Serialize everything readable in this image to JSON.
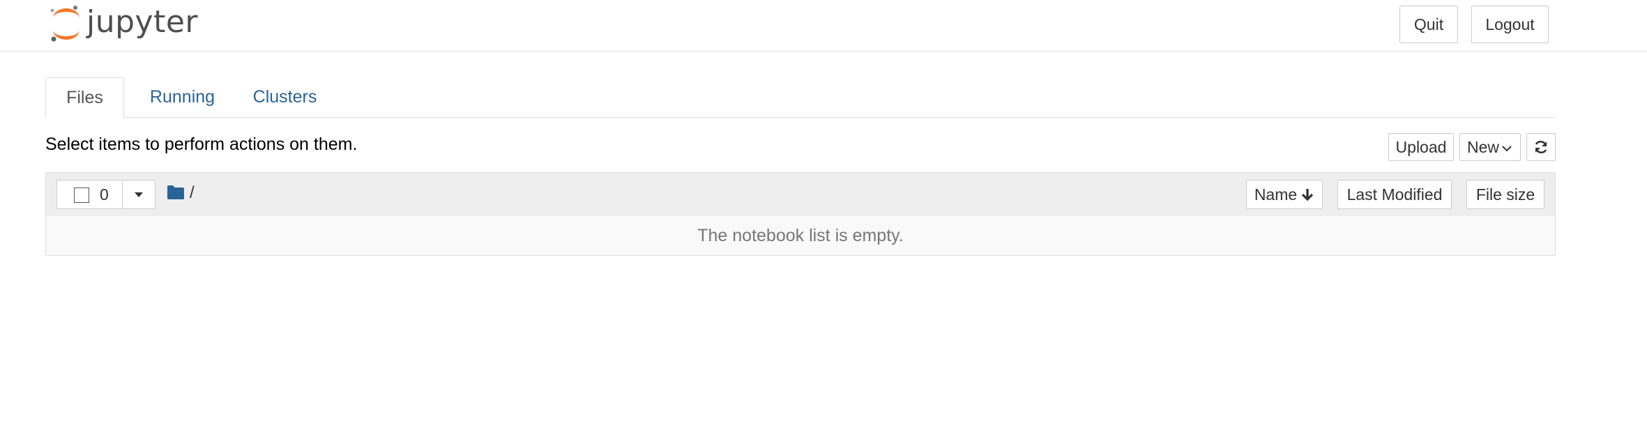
{
  "header": {
    "logo_text": "jupyter",
    "quit_label": "Quit",
    "logout_label": "Logout"
  },
  "tabs": [
    {
      "label": "Files",
      "active": true
    },
    {
      "label": "Running",
      "active": false
    },
    {
      "label": "Clusters",
      "active": false
    }
  ],
  "files": {
    "instructions": "Select items to perform actions on them.",
    "upload_label": "Upload",
    "new_label": "New",
    "selected_count": "0",
    "path": "/",
    "sort_buttons": {
      "name": "Name",
      "last_modified": "Last Modified",
      "file_size": "File size"
    },
    "empty_message": "The notebook list is empty."
  },
  "colors": {
    "link": "#2a6496",
    "logo_orange": "#F37726",
    "folder_blue": "#2a6496",
    "border": "#cccccc",
    "list_header_bg": "#eeeeee"
  },
  "icons": [
    "jupyter-logo-icon",
    "refresh-icon",
    "caret-down-icon",
    "folder-icon",
    "arrow-down-icon",
    "checkbox-icon"
  ]
}
